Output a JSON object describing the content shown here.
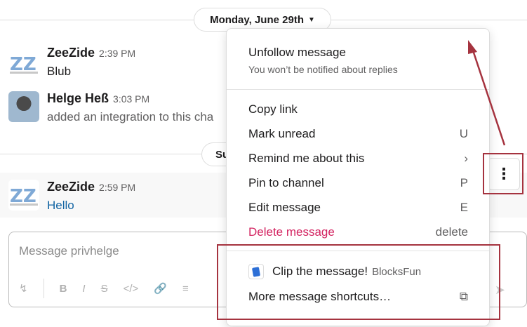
{
  "date_divider": {
    "label": "Monday, June 29th"
  },
  "date_divider_2": {
    "label": "Su"
  },
  "messages": [
    {
      "author": "ZeeZide",
      "time": "2:39 PM",
      "text": "Blub"
    },
    {
      "author": "Helge Heß",
      "time": "3:03 PM",
      "text": "added an integration to this cha"
    },
    {
      "author": "ZeeZide",
      "time": "2:59 PM",
      "text": "Hello"
    }
  ],
  "composer": {
    "placeholder": "Message privhelge"
  },
  "context_menu": {
    "unfollow": {
      "label": "Unfollow message",
      "subtitle": "You won’t be notified about replies"
    },
    "items": [
      {
        "label": "Copy link",
        "shortcut": ""
      },
      {
        "label": "Mark unread",
        "shortcut": "U"
      },
      {
        "label": "Remind me about this",
        "shortcut": "›"
      },
      {
        "label": "Pin to channel",
        "shortcut": "P"
      },
      {
        "label": "Edit message",
        "shortcut": "E"
      },
      {
        "label": "Delete message",
        "shortcut": "delete"
      }
    ],
    "shortcut_item": {
      "label": "Clip the message!",
      "app": "BlocksFun"
    },
    "more_shortcuts": {
      "label": "More message shortcuts…"
    }
  },
  "colors": {
    "annotation_red": "#a5333f",
    "danger": "#d32360",
    "link": "#1264a3"
  }
}
